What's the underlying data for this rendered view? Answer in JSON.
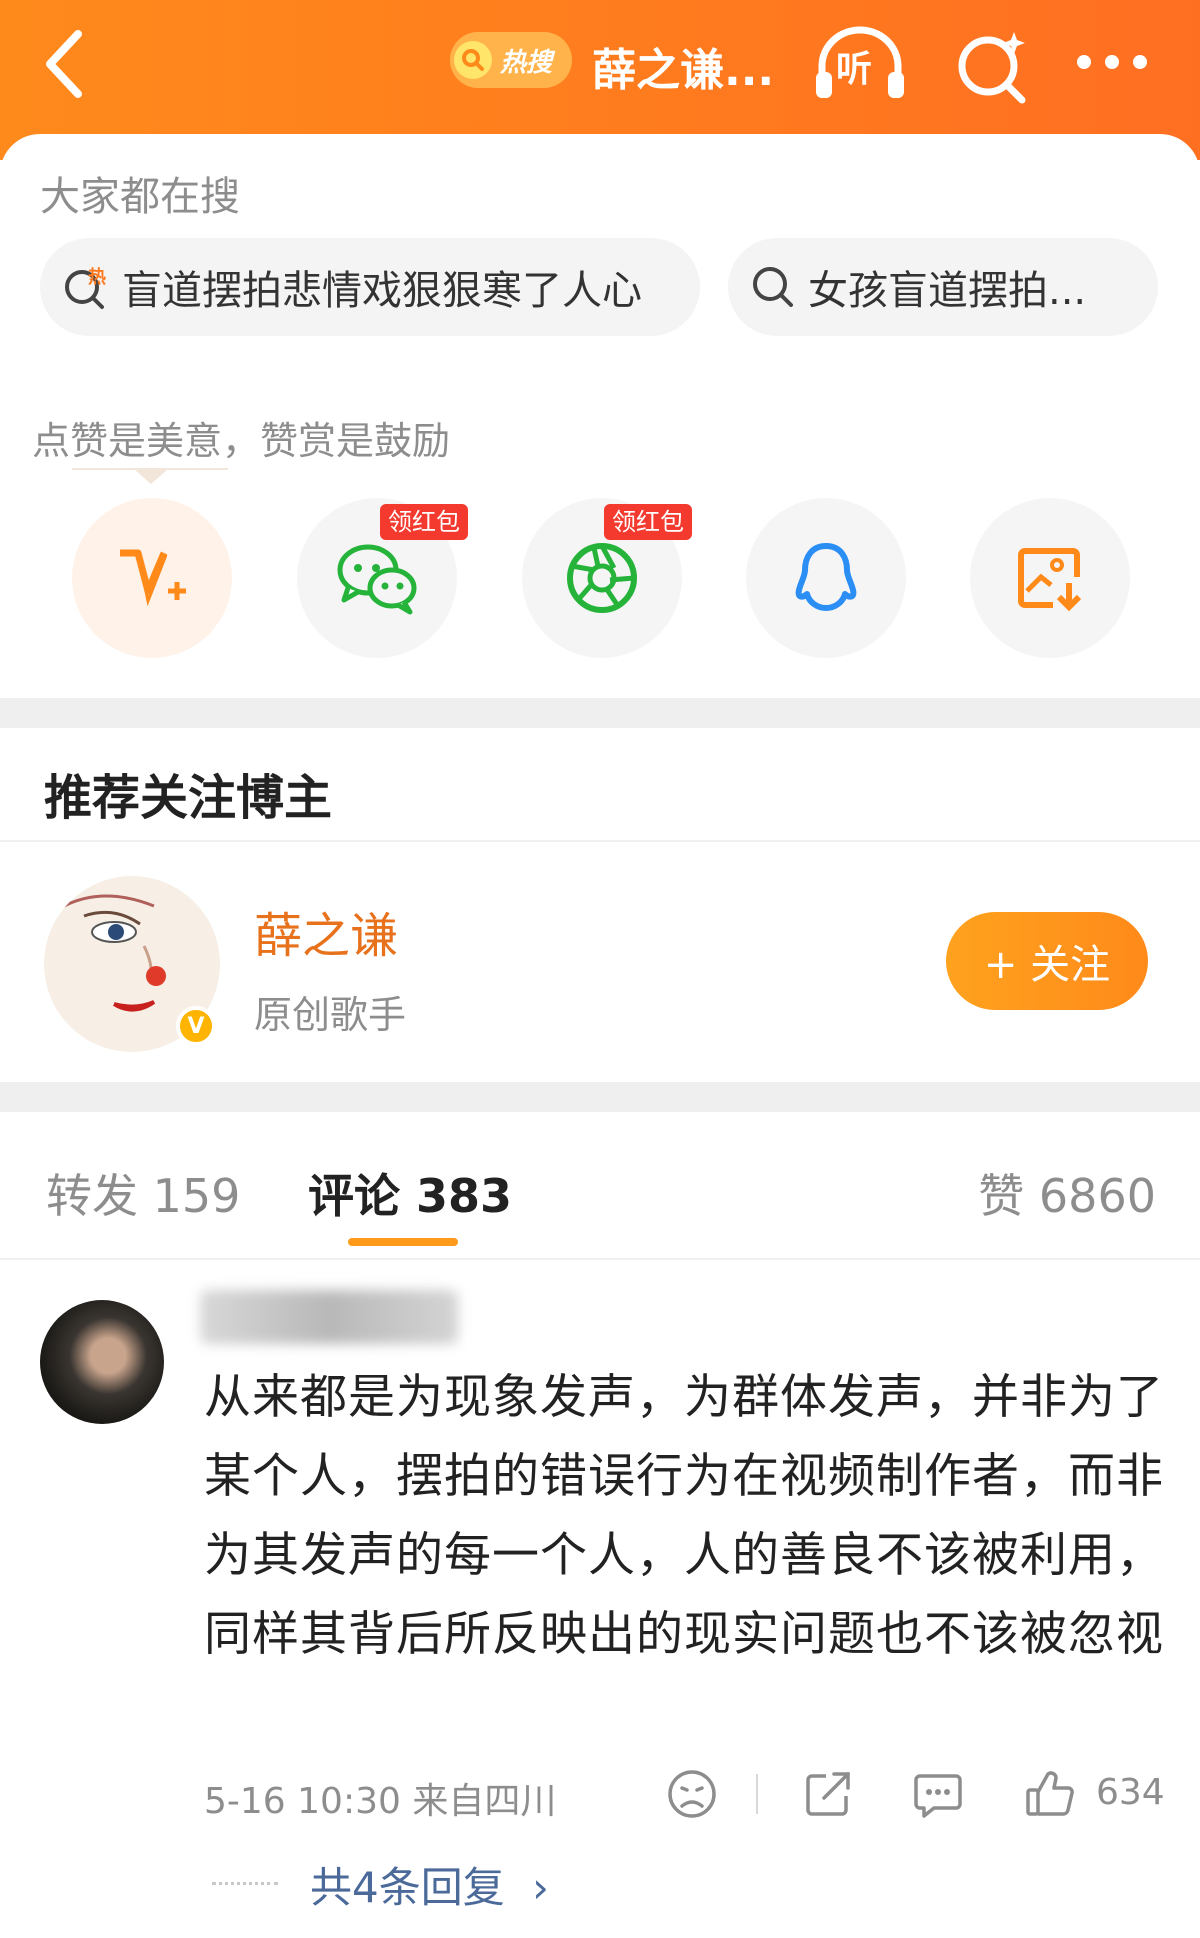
{
  "header": {
    "hot_badge": "热搜",
    "title": "薛之谦...",
    "listen_label": "听"
  },
  "trending": {
    "label": "大家都在搜",
    "items": [
      {
        "text": "盲道摆拍悲情戏狠狠寒了人心",
        "icon": "hot-search-icon"
      },
      {
        "text": "女孩盲道摆拍...",
        "icon": "search-icon"
      }
    ]
  },
  "reward": {
    "label": "点赞是美意，赞赏是鼓励",
    "share_targets": [
      {
        "name": "weibo-vplus",
        "tag": ""
      },
      {
        "name": "wechat",
        "tag": "领红包"
      },
      {
        "name": "moments",
        "tag": "领红包"
      },
      {
        "name": "qq",
        "tag": ""
      },
      {
        "name": "save-image",
        "tag": ""
      }
    ]
  },
  "recommend": {
    "title": "推荐关注博主",
    "blogger": {
      "name": "薛之谦",
      "desc": "原创歌手",
      "follow_label": "+ 关注",
      "verified_badge": "V"
    }
  },
  "tabs": {
    "repost": "转发 159",
    "comment": "评论 383",
    "like": "赞 6860"
  },
  "comment": {
    "text": "从来都是为现象发声，为群体发声，并非为了某个人，摆拍的错误行为在视频制作者，而非为其发声的每一个人，人的善良不该被利用，同样其背后所反映出的现实问题也不该被忽视",
    "meta": "5-16 10:30  来自四川",
    "like_count": "634",
    "replies": "共4条回复"
  },
  "colors": {
    "header_orange": "#ff7e1e",
    "accent_orange": "#ff9a1a",
    "link_blue": "#4b6a9a",
    "tag_red": "#f43a2e"
  }
}
